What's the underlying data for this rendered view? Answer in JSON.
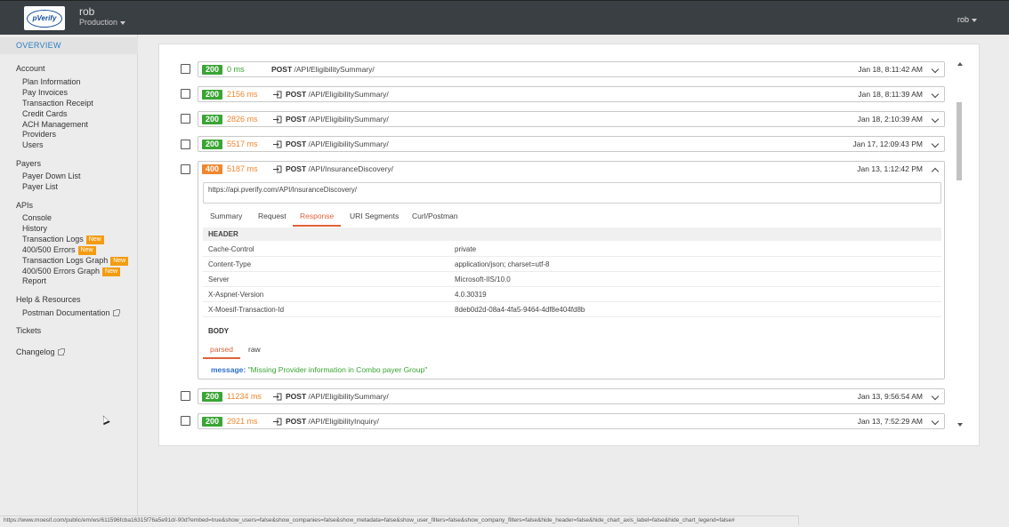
{
  "topbar": {
    "logo_text": "pVerify",
    "user_name": "rob",
    "environment": "Production",
    "user_menu": "rob"
  },
  "sidebar": {
    "overview": "OVERVIEW",
    "sections": [
      {
        "title": "Account",
        "items": [
          {
            "label": "Plan Information"
          },
          {
            "label": "Pay Invoices"
          },
          {
            "label": "Transaction Receipt"
          },
          {
            "label": "Credit Cards"
          },
          {
            "label": "ACH Management"
          },
          {
            "label": "Providers"
          },
          {
            "label": "Users"
          }
        ]
      },
      {
        "title": "Payers",
        "items": [
          {
            "label": "Payer Down List"
          },
          {
            "label": "Payer List"
          }
        ]
      },
      {
        "title": "APIs",
        "items": [
          {
            "label": "Console"
          },
          {
            "label": "History"
          },
          {
            "label": "Transaction Logs",
            "badge": "New"
          },
          {
            "label": "400/500 Errors",
            "badge": "New"
          },
          {
            "label": "Transaction Logs Graph",
            "badge": "New"
          },
          {
            "label": "400/500 Errors Graph",
            "badge": "New"
          },
          {
            "label": "Report"
          }
        ]
      },
      {
        "title": "Help & Resources",
        "items": [
          {
            "label": "Postman Documentation"
          }
        ]
      }
    ],
    "tickets": "Tickets",
    "changelog": "Changelog"
  },
  "logs": [
    {
      "status": "200",
      "duration": "0 ms",
      "method": "POST",
      "path": "/API/EligibilitySummary/",
      "time": "Jan 18, 8:11:42 AM",
      "duration_color": "green",
      "icon": false
    },
    {
      "status": "200",
      "duration": "2156 ms",
      "method": "POST",
      "path": "/API/EligibilitySummary/",
      "time": "Jan 18, 8:11:39 AM",
      "duration_color": "orange",
      "icon": true
    },
    {
      "status": "200",
      "duration": "2826 ms",
      "method": "POST",
      "path": "/API/EligibilitySummary/",
      "time": "Jan 18, 2:10:39 AM",
      "duration_color": "orange",
      "icon": true
    },
    {
      "status": "200",
      "duration": "5517 ms",
      "method": "POST",
      "path": "/API/EligibilitySummary/",
      "time": "Jan 17, 12:09:43 PM",
      "duration_color": "orange",
      "icon": true
    },
    {
      "status": "400",
      "duration": "5187 ms",
      "method": "POST",
      "path": "/API/InsuranceDiscovery/",
      "time": "Jan 13, 1:12:42 PM",
      "duration_color": "orange",
      "icon": true
    },
    {
      "status": "200",
      "duration": "11234 ms",
      "method": "POST",
      "path": "/API/EligibilitySummary/",
      "time": "Jan 13, 9:56:54 AM",
      "duration_color": "orange",
      "icon": true
    },
    {
      "status": "200",
      "duration": "2921 ms",
      "method": "POST",
      "path": "/API/EligibilityInquiry/",
      "time": "Jan 13, 7:52:29 AM",
      "duration_color": "orange",
      "icon": true
    }
  ],
  "detail": {
    "url": "https://api.pverify.com/API/InsuranceDiscovery/",
    "tabs": [
      "Summary",
      "Request",
      "Response",
      "URI Segments",
      "Curl/Postman"
    ],
    "active_tab": "Response",
    "header_title": "HEADER",
    "headers": [
      {
        "key": "Cache-Control",
        "value": "private"
      },
      {
        "key": "Content-Type",
        "value": "application/json; charset=utf-8"
      },
      {
        "key": "Server",
        "value": "Microsoft-IIS/10.0"
      },
      {
        "key": "X-Aspnet-Version",
        "value": "4.0.30319"
      },
      {
        "key": "X-Moesif-Transaction-Id",
        "value": "8deb0d2d-08a4-4fa5-9464-4df8e404fd8b"
      }
    ],
    "body_title": "BODY",
    "body_tabs": [
      "parsed",
      "raw"
    ],
    "active_body_tab": "parsed",
    "message_key": "message:",
    "message_value": "\"Missing Provider information in Combo payer Group\""
  },
  "statusbar": {
    "url": "https://www.moesif.com/public/em/ws/611596fcba16315f76a5e91d/-90d?embed=true&show_users=false&show_companies=false&show_metadata=false&show_user_filters=false&show_company_filters=false&hide_header=false&hide_chart_axis_label=false&hide_chart_legend=false#"
  },
  "colors": {
    "accent_blue": "#2a7ec0",
    "success_green": "#3aa535",
    "warning_orange": "#f0862d",
    "active_tab": "#e0623a",
    "badge_new": "#f39c12",
    "topbar": "#3a3f44"
  }
}
